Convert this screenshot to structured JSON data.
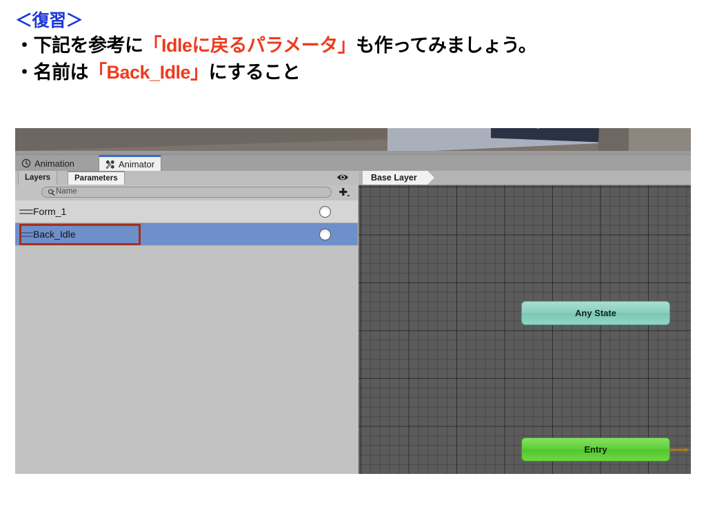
{
  "slide": {
    "heading": "＜復習＞",
    "bullets": [
      {
        "segments": [
          {
            "text": "・下記を参考に",
            "color": "black"
          },
          {
            "text": "「Idleに戻るパラメータ」",
            "color": "red"
          },
          {
            "text": "も作ってみましょう。",
            "color": "black"
          }
        ]
      },
      {
        "segments": [
          {
            "text": "・名前は",
            "color": "black"
          },
          {
            "text": "「Back_Idle」",
            "color": "red"
          },
          {
            "text": "にすること",
            "color": "black"
          }
        ]
      }
    ],
    "colors": {
      "heading": "#1a36d8",
      "highlight": "#ee3b1e",
      "body": "#000000"
    }
  },
  "unity": {
    "window_tabs": [
      {
        "label": "Animation",
        "icon": "clock-icon",
        "active": false
      },
      {
        "label": "Animator",
        "icon": "animator-state-machine-icon",
        "active": true
      }
    ],
    "sub_tabs": [
      {
        "label": "Layers",
        "active": false
      },
      {
        "label": "Parameters",
        "active": true
      }
    ],
    "toolbar": {
      "eye_icon": "eye-icon",
      "add_icon": "plus-dropdown-icon"
    },
    "search": {
      "placeholder": "Name",
      "value": "",
      "icon": "search-magnifier-icon"
    },
    "parameters": [
      {
        "name": "Form_1",
        "type": "trigger",
        "selected": false,
        "annotated": false
      },
      {
        "name": "Back_Idle",
        "type": "trigger",
        "selected": true,
        "annotated": true
      }
    ],
    "breadcrumb": "Base Layer",
    "graph": {
      "nodes": [
        {
          "label": "Any State",
          "kind": "any-state",
          "color": "#89cfc1"
        },
        {
          "label": "Entry",
          "kind": "entry",
          "color": "#5fcf39"
        }
      ],
      "transition_color": "#b5781a"
    },
    "colors": {
      "selection_row": "#6f8fca",
      "annotation_box": "#a4301a",
      "panel_bg": "#c2c2c2",
      "canvas_bg": "#5b5b5b"
    }
  }
}
